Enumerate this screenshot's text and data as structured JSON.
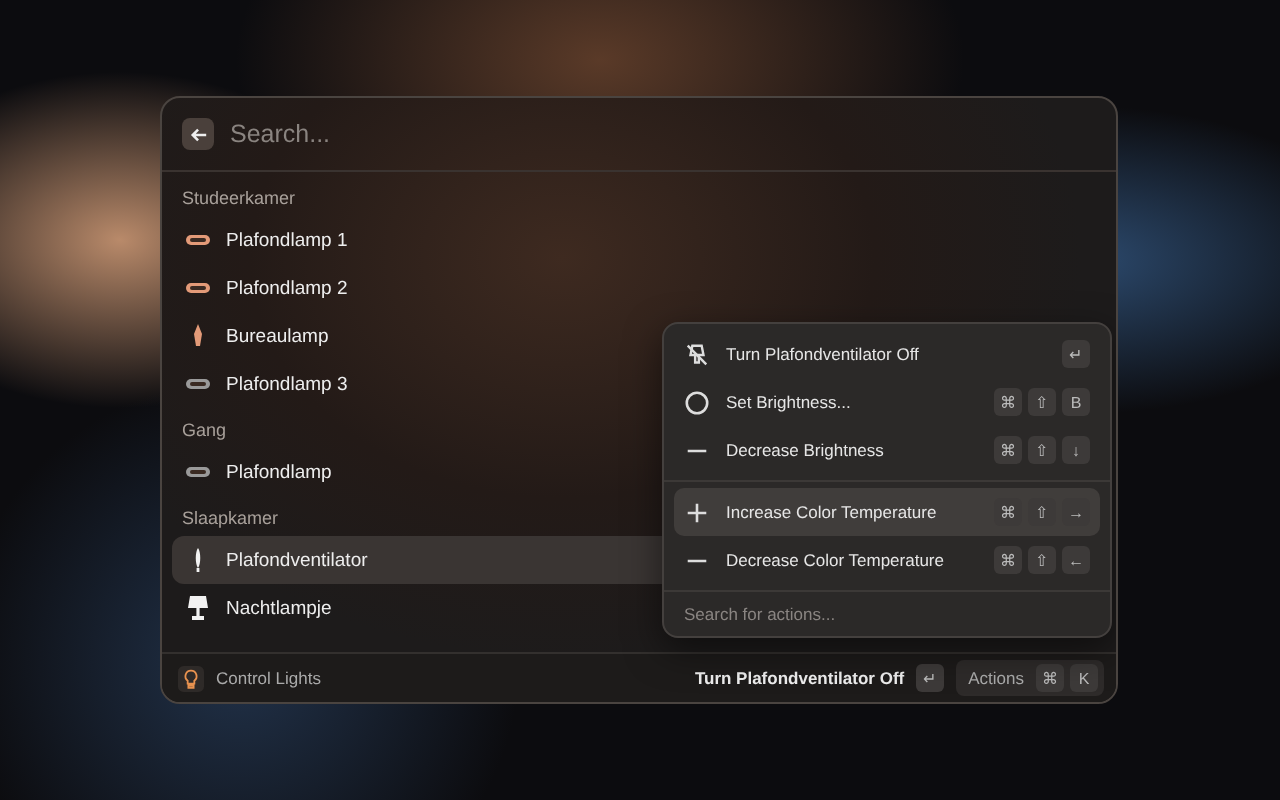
{
  "search": {
    "placeholder": "Search..."
  },
  "groups": [
    {
      "title": "Studeerkamer",
      "items": [
        {
          "label": "Plafondlamp 1",
          "kind": "ceiling",
          "color": "#e39a78",
          "selected": false
        },
        {
          "label": "Plafondlamp 2",
          "kind": "ceiling",
          "color": "#e39a78",
          "selected": false
        },
        {
          "label": "Bureaulamp",
          "kind": "desk",
          "color": "#e39a78",
          "selected": false
        },
        {
          "label": "Plafondlamp 3",
          "kind": "ceiling",
          "color": "#9a9a9a",
          "selected": false
        }
      ]
    },
    {
      "title": "Gang",
      "items": [
        {
          "label": "Plafondlamp",
          "kind": "ceiling",
          "color": "#9a9a9a",
          "selected": false
        }
      ]
    },
    {
      "title": "Slaapkamer",
      "items": [
        {
          "label": "Plafondventilator",
          "kind": "fan",
          "color": "#f2f2f2",
          "selected": true
        },
        {
          "label": "Nachtlampje",
          "kind": "night",
          "color": "#f2f2f2",
          "selected": false
        }
      ]
    }
  ],
  "actions": {
    "sections": [
      [
        {
          "label": "Turn Plafondventilator Off",
          "kind": "off",
          "keys": [
            "↵"
          ],
          "selected": false
        },
        {
          "label": "Set Brightness...",
          "kind": "circle",
          "keys": [
            "⌘",
            "⇧",
            "B"
          ],
          "selected": false
        },
        {
          "label": "Decrease Brightness",
          "kind": "minus",
          "keys": [
            "⌘",
            "⇧",
            "↓"
          ],
          "selected": false
        }
      ],
      [
        {
          "label": "Increase Color Temperature",
          "kind": "plus",
          "keys": [
            "⌘",
            "⇧",
            "→"
          ],
          "selected": true
        },
        {
          "label": "Decrease Color Temperature",
          "kind": "minus",
          "keys": [
            "⌘",
            "⇧",
            "←"
          ],
          "selected": false
        }
      ]
    ],
    "search": {
      "placeholder": "Search for actions..."
    }
  },
  "footer": {
    "title": "Control Lights",
    "primary": "Turn Plafondventilator Off",
    "primary_keys": [
      "↵"
    ],
    "actions": "Actions",
    "actions_keys": [
      "⌘",
      "K"
    ]
  }
}
